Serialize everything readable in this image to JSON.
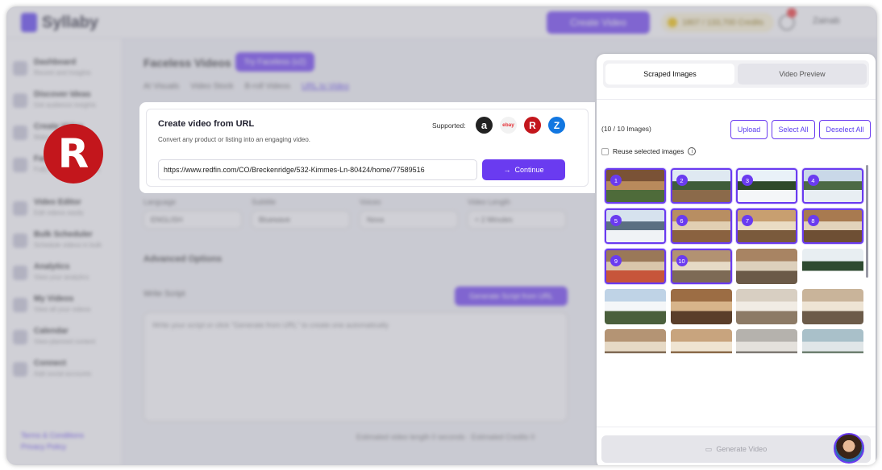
{
  "app": {
    "logo_text": "Syllaby",
    "create_video_label": "Create Video",
    "credits_label": "1807 / 133,700 Credits",
    "user_label": "Zainab"
  },
  "sidebar": {
    "items": [
      {
        "title": "Dashboard",
        "sub": "Recent and Insights"
      },
      {
        "title": "Discover Ideas",
        "sub": "Get audience insights"
      },
      {
        "title": "Create Video",
        "sub": "Make a video"
      },
      {
        "title": "Faceless Video",
        "sub": "Fully automated videos"
      },
      {
        "title": "Video Editor",
        "sub": "Edit videos easily"
      },
      {
        "title": "Bulk Scheduler",
        "sub": "Schedule videos in bulk"
      },
      {
        "title": "Analytics",
        "sub": "View your analytics"
      },
      {
        "title": "My Videos",
        "sub": "View all your videos"
      },
      {
        "title": "Calendar",
        "sub": "View planned content"
      },
      {
        "title": "Connect",
        "sub": "Add social accounts"
      }
    ],
    "links": [
      "Terms & Conditions",
      "Privacy Policy"
    ]
  },
  "main": {
    "title": "Faceless Videos",
    "try_button": "Try Faceless (v2)",
    "mode_tabs": [
      "AI Visuals",
      "Video Stock",
      "B-roll Videos",
      "URL to Video"
    ],
    "fields": [
      {
        "label": "Language",
        "value": "ENGLISH"
      },
      {
        "label": "Subtitle",
        "value": "Bluewave"
      },
      {
        "label": "Voices",
        "value": "Nova"
      },
      {
        "label": "Video Length",
        "value": "< 2 Minutes"
      }
    ],
    "advanced_label": "Advanced Options",
    "write_script_label": "Write Script",
    "generate_script_label": "Generate Script from URL",
    "script_placeholder": "Write your script or click \"Generate from URL\" to create one automatically",
    "estimate_text": "Estimated video length 0 seconds  ·  Estimated Credits 0"
  },
  "url_card": {
    "title": "Create video from URL",
    "subtitle": "Convert any product or listing into an engaging video.",
    "supported_label": "Supported:",
    "platforms": [
      {
        "name": "amazon-logo",
        "glyph": "a",
        "bg": "#222222",
        "fg": "#ffffff"
      },
      {
        "name": "ebay-logo",
        "glyph": "ebay",
        "bg": "#f2f2f2",
        "fg": "#e53238"
      },
      {
        "name": "redfin-logo",
        "glyph": "R",
        "bg": "#c3161c",
        "fg": "#ffffff"
      },
      {
        "name": "zillow-logo",
        "glyph": "Z",
        "bg": "#1277e1",
        "fg": "#ffffff"
      }
    ],
    "url_value": "https://www.redfin.com/CO/Breckenridge/532-Kimmes-Ln-80424/home/77589516",
    "continue_label": "Continue"
  },
  "overlay_logo": {
    "glyph": "R",
    "color": "#c3161c"
  },
  "panel": {
    "tabs": [
      "Scraped Images",
      "Video Preview"
    ],
    "count_label": "(10 / 10 Images)",
    "buttons": [
      "Upload",
      "Select All",
      "Deselect All"
    ],
    "reuse_label": "Reuse selected images",
    "info_glyph": "i",
    "images": [
      {
        "selected": true,
        "badge": "1",
        "colors": [
          "#7a5236",
          "#b98a5c",
          "#4e6b3a"
        ]
      },
      {
        "selected": true,
        "badge": "2",
        "colors": [
          "#dfe9f2",
          "#3f5d3a",
          "#8b6a4a"
        ]
      },
      {
        "selected": true,
        "badge": "3",
        "colors": [
          "#e9f1f8",
          "#2f4a2a",
          "#f4f6f8"
        ]
      },
      {
        "selected": true,
        "badge": "4",
        "colors": [
          "#c9d8e8",
          "#4c6a46",
          "#e8eef3"
        ]
      },
      {
        "selected": true,
        "badge": "5",
        "colors": [
          "#d6e2ee",
          "#5a6f82",
          "#f0f3f6"
        ]
      },
      {
        "selected": true,
        "badge": "6",
        "colors": [
          "#b88e62",
          "#e1cfb2",
          "#8a6240"
        ]
      },
      {
        "selected": true,
        "badge": "7",
        "colors": [
          "#c89f70",
          "#eadcc4",
          "#7a5a3c"
        ]
      },
      {
        "selected": true,
        "badge": "8",
        "colors": [
          "#a87a50",
          "#e2d3bb",
          "#6e4f34"
        ]
      },
      {
        "selected": true,
        "badge": "9",
        "colors": [
          "#9a7858",
          "#d9c6ab",
          "#c7553a"
        ]
      },
      {
        "selected": true,
        "badge": "10",
        "colors": [
          "#b29272",
          "#e6dac6",
          "#7d6a55"
        ]
      },
      {
        "selected": false,
        "badge": "",
        "colors": [
          "#a88463",
          "#ddd0bc",
          "#6b5a48"
        ]
      },
      {
        "selected": false,
        "badge": "",
        "colors": [
          "#e8eef2",
          "#2e4a30",
          "#ffffff"
        ]
      },
      {
        "selected": false,
        "badge": "",
        "colors": [
          "#bfd3e6",
          "#f4f6f8",
          "#4a5f3c"
        ]
      },
      {
        "selected": false,
        "badge": "",
        "colors": [
          "#9c6d44",
          "#d7b48a",
          "#5a3e2a"
        ]
      },
      {
        "selected": false,
        "badge": "",
        "colors": [
          "#d8cfc2",
          "#f1ece4",
          "#8c7a66"
        ]
      },
      {
        "selected": false,
        "badge": "",
        "colors": [
          "#c9b49a",
          "#eee4d4",
          "#6c5b49"
        ]
      },
      {
        "selected": false,
        "badge": "",
        "colors": [
          "#b49474",
          "#e6d9c5",
          "#806a54"
        ]
      },
      {
        "selected": false,
        "badge": "",
        "colors": [
          "#c8a47e",
          "#efe4d2",
          "#8a6a4a"
        ]
      },
      {
        "selected": false,
        "badge": "",
        "colors": [
          "#b5b2ad",
          "#e4e1dc",
          "#7e7a74"
        ]
      },
      {
        "selected": false,
        "badge": "",
        "colors": [
          "#a9c0c9",
          "#e0e6e8",
          "#6e7f70"
        ]
      }
    ],
    "generate_label": "Generate Video"
  }
}
